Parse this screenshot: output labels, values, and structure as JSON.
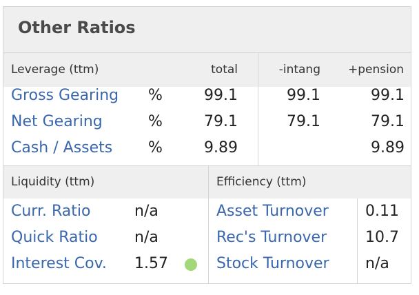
{
  "title": "Other Ratios",
  "leverage": {
    "header": "Leverage (ttm)",
    "columns": [
      "total",
      "-intang",
      "+pension"
    ],
    "rows": [
      {
        "label": "Gross Gearing",
        "unit": "%",
        "total": "99.1",
        "intang": "99.1",
        "pension": "99.1"
      },
      {
        "label": "Net Gearing",
        "unit": "%",
        "total": "79.1",
        "intang": "79.1",
        "pension": "79.1"
      },
      {
        "label": "Cash / Assets",
        "unit": "%",
        "total": "9.89",
        "intang": "",
        "pension": "9.89"
      }
    ]
  },
  "liquidity": {
    "header": "Liquidity (ttm)",
    "rows": [
      {
        "label": "Curr. Ratio",
        "value": "n/a"
      },
      {
        "label": "Quick Ratio",
        "value": "n/a"
      },
      {
        "label": "Interest Cov.",
        "value": "1.57",
        "status_color": "#a3d77a"
      }
    ]
  },
  "efficiency": {
    "header": "Efficiency (ttm)",
    "rows": [
      {
        "label": "Asset Turnover",
        "value": "0.11"
      },
      {
        "label": "Rec's Turnover",
        "value": "10.7"
      },
      {
        "label": "Stock Turnover",
        "value": "n/a"
      }
    ]
  },
  "colors": {
    "link": "#3a67ad",
    "header_bg": "#efefef",
    "border": "#d4d4d4",
    "status_good": "#a3d77a"
  }
}
